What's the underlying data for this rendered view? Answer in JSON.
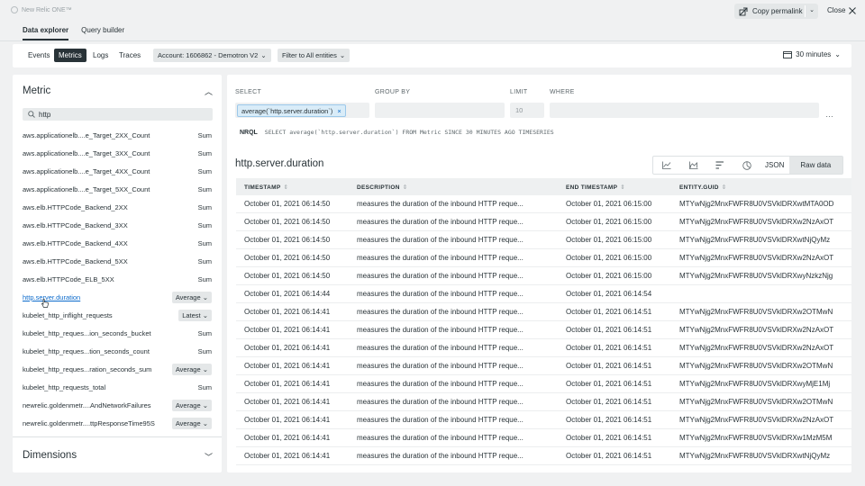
{
  "app": {
    "brand": "New Relic ONE™"
  },
  "header": {
    "copy_permalink": "Copy permalink",
    "close": "Close"
  },
  "tabs": [
    {
      "label": "Data explorer"
    },
    {
      "label": "Query builder"
    }
  ],
  "filters": {
    "data_types": [
      {
        "label": "Events"
      },
      {
        "label": "Metrics"
      },
      {
        "label": "Logs"
      },
      {
        "label": "Traces"
      }
    ],
    "account": "Account: 1606862 - Demotron V2",
    "entity_filter": "Filter to All entities",
    "time_range": "30 minutes"
  },
  "metric_panel": {
    "title": "Metric",
    "search_value": "http",
    "items": [
      {
        "name": "aws.applicationelb....e_Target_2XX_Count",
        "agg": "Sum"
      },
      {
        "name": "aws.applicationelb....e_Target_3XX_Count",
        "agg": "Sum"
      },
      {
        "name": "aws.applicationelb....e_Target_4XX_Count",
        "agg": "Sum"
      },
      {
        "name": "aws.applicationelb....e_Target_5XX_Count",
        "agg": "Sum"
      },
      {
        "name": "aws.elb.HTTPCode_Backend_2XX",
        "agg": "Sum"
      },
      {
        "name": "aws.elb.HTTPCode_Backend_3XX",
        "agg": "Sum"
      },
      {
        "name": "aws.elb.HTTPCode_Backend_4XX",
        "agg": "Sum"
      },
      {
        "name": "aws.elb.HTTPCode_Backend_5XX",
        "agg": "Sum"
      },
      {
        "name": "aws.elb.HTTPCode_ELB_5XX",
        "agg": "Sum"
      },
      {
        "name": "http.server.duration",
        "agg": "Average"
      },
      {
        "name": "kubelet_http_inflight_requests",
        "agg": "Latest"
      },
      {
        "name": "kubelet_http_reques...ion_seconds_bucket",
        "agg": "Sum"
      },
      {
        "name": "kubelet_http_reques...tion_seconds_count",
        "agg": "Sum"
      },
      {
        "name": "kubelet_http_reques...ration_seconds_sum",
        "agg": "Average"
      },
      {
        "name": "kubelet_http_requests_total",
        "agg": "Sum"
      },
      {
        "name": "newrelic.goldenmetr....AndNetworkFailures",
        "agg": "Average"
      },
      {
        "name": "newrelic.goldenmetr....ttpResponseTime95S",
        "agg": "Average"
      }
    ],
    "dimensions_title": "Dimensions"
  },
  "query": {
    "select_label": "SELECT",
    "group_by_label": "GROUP BY",
    "limit_label": "LIMIT",
    "where_label": "WHERE",
    "select_chip": "average(`http.server.duration`)",
    "limit_value": "10",
    "nrql_label": "NRQL",
    "nrql": "SELECT average(`http.server.duration`) FROM Metric SINCE 30 MINUTES AGO TIMESERIES"
  },
  "results": {
    "title": "http.server.duration",
    "view_json": "JSON",
    "view_raw": "Raw data",
    "columns": [
      "TIMESTAMP",
      "DESCRIPTION",
      "END TIMESTAMP",
      "ENTITY.GUID"
    ],
    "rows": [
      [
        "October 01, 2021 06:14:50",
        "measures the duration of the inbound HTTP reque...",
        "October 01, 2021 06:15:00",
        "MTYwNjg2MnxFWFR8U0VSVklDRXwtMTA0OD"
      ],
      [
        "October 01, 2021 06:14:50",
        "measures the duration of the inbound HTTP reque...",
        "October 01, 2021 06:15:00",
        "MTYwNjg2MnxFWFR8U0VSVklDRXw2NzAxOT"
      ],
      [
        "October 01, 2021 06:14:50",
        "measures the duration of the inbound HTTP reque...",
        "October 01, 2021 06:15:00",
        "MTYwNjg2MnxFWFR8U0VSVklDRXwtNjQyMz"
      ],
      [
        "October 01, 2021 06:14:50",
        "measures the duration of the inbound HTTP reque...",
        "October 01, 2021 06:15:00",
        "MTYwNjg2MnxFWFR8U0VSVklDRXw2NzAxOT"
      ],
      [
        "October 01, 2021 06:14:50",
        "measures the duration of the inbound HTTP reque...",
        "October 01, 2021 06:15:00",
        "MTYwNjg2MnxFWFR8U0VSVklDRXwyNzkzNjg"
      ],
      [
        "October 01, 2021 06:14:44",
        "measures the duration of the inbound HTTP reque...",
        "October 01, 2021 06:14:54",
        ""
      ],
      [
        "October 01, 2021 06:14:41",
        "measures the duration of the inbound HTTP reque...",
        "October 01, 2021 06:14:51",
        "MTYwNjg2MnxFWFR8U0VSVklDRXw2OTMwN"
      ],
      [
        "October 01, 2021 06:14:41",
        "measures the duration of the inbound HTTP reque...",
        "October 01, 2021 06:14:51",
        "MTYwNjg2MnxFWFR8U0VSVklDRXw2NzAxOT"
      ],
      [
        "October 01, 2021 06:14:41",
        "measures the duration of the inbound HTTP reque...",
        "October 01, 2021 06:14:51",
        "MTYwNjg2MnxFWFR8U0VSVklDRXw2NzAxOT"
      ],
      [
        "October 01, 2021 06:14:41",
        "measures the duration of the inbound HTTP reque...",
        "October 01, 2021 06:14:51",
        "MTYwNjg2MnxFWFR8U0VSVklDRXw2OTMwN"
      ],
      [
        "October 01, 2021 06:14:41",
        "measures the duration of the inbound HTTP reque...",
        "October 01, 2021 06:14:51",
        "MTYwNjg2MnxFWFR8U0VSVklDRXwyMjE1Mj"
      ],
      [
        "October 01, 2021 06:14:41",
        "measures the duration of the inbound HTTP reque...",
        "October 01, 2021 06:14:51",
        "MTYwNjg2MnxFWFR8U0VSVklDRXw2OTMwN"
      ],
      [
        "October 01, 2021 06:14:41",
        "measures the duration of the inbound HTTP reque...",
        "October 01, 2021 06:14:51",
        "MTYwNjg2MnxFWFR8U0VSVklDRXw2NzAxOT"
      ],
      [
        "October 01, 2021 06:14:41",
        "measures the duration of the inbound HTTP reque...",
        "October 01, 2021 06:14:51",
        "MTYwNjg2MnxFWFR8U0VSVklDRXw1MzM5M"
      ],
      [
        "October 01, 2021 06:14:41",
        "measures the duration of the inbound HTTP reque...",
        "October 01, 2021 06:14:51",
        "MTYwNjg2MnxFWFR8U0VSVklDRXwtNjQyMz"
      ]
    ]
  }
}
